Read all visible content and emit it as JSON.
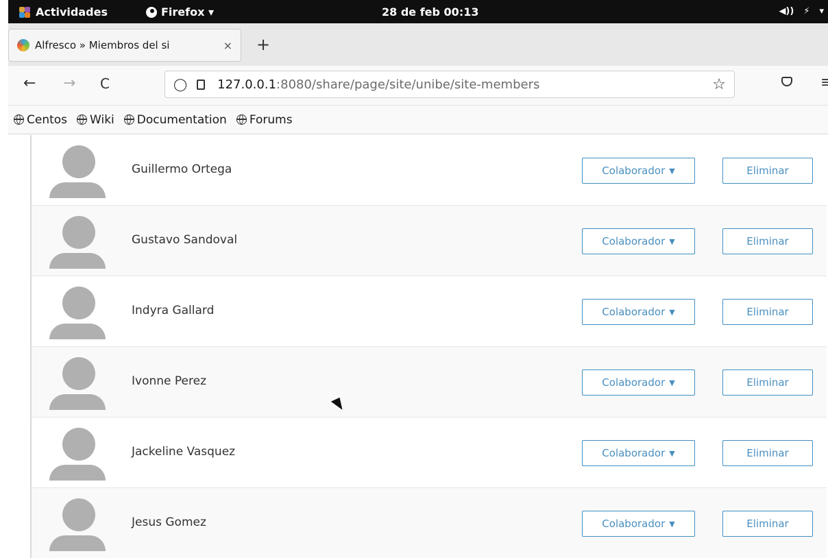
{
  "topbar": {
    "activities": "Actividades",
    "app_name": "Firefox ▾",
    "clock": "28 de feb  00:13",
    "tray": [
      "◀))",
      "⚡",
      "▾"
    ]
  },
  "tab": {
    "title": "Alfresco » Miembros del si",
    "close": "×",
    "new_tab": "+"
  },
  "navbar": {
    "back": "←",
    "forward": "→",
    "reload": "C",
    "url_host": "127.0.0.1",
    "url_path": ":8080/share/page/site/unibe/site-members",
    "bookmark_star": "☆",
    "menu": "≡"
  },
  "bookmarks": [
    "Centos",
    "Wiki",
    "Documentation",
    "Forums"
  ],
  "members": [
    {
      "name": "Guillermo Ortega",
      "role": "Colaborador",
      "remove": "Eliminar"
    },
    {
      "name": "Gustavo Sandoval",
      "role": "Colaborador",
      "remove": "Eliminar"
    },
    {
      "name": "Indyra Gallard",
      "role": "Colaborador",
      "remove": "Eliminar"
    },
    {
      "name": "Ivonne Perez",
      "role": "Colaborador",
      "remove": "Eliminar"
    },
    {
      "name": "Jackeline Vasquez",
      "role": "Colaborador",
      "remove": "Eliminar"
    },
    {
      "name": "Jesus Gomez",
      "role": "Colaborador",
      "remove": "Eliminar"
    }
  ],
  "colors": {
    "accent": "#3f8fc4",
    "avatar": "#b0b0b0",
    "topbar": "#0f0f0f"
  }
}
